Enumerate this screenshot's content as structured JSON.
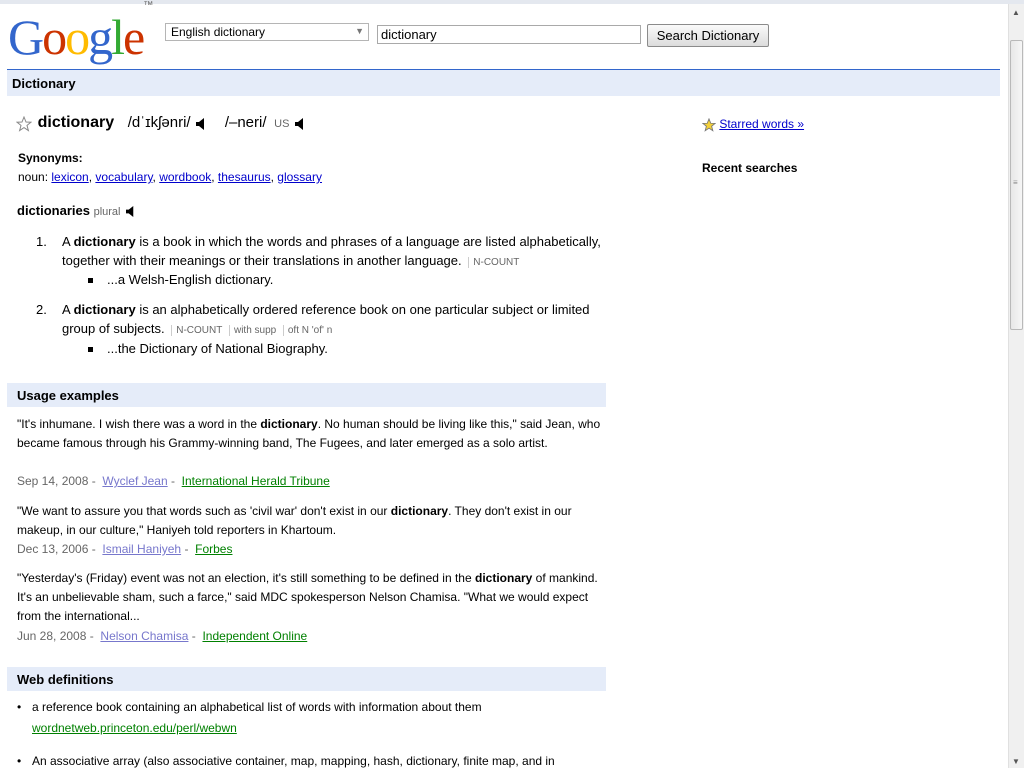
{
  "logo": {
    "letters": [
      "G",
      "o",
      "o",
      "g",
      "l",
      "e"
    ],
    "colors": [
      "#3366cc",
      "#cc3300",
      "#ffbb00",
      "#3366cc",
      "#33aa33",
      "#cc3300"
    ],
    "tm": "™"
  },
  "header": {
    "language": "English dictionary",
    "query": "dictionary",
    "search_button": "Search Dictionary"
  },
  "section_bar": "Dictionary",
  "entry": {
    "word": "dictionary",
    "ipa_uk": "/dˈɪkʃənri/",
    "ipa_us": "/–neri/",
    "us_label": "US",
    "synonyms_heading": "Synonyms:",
    "synonyms_pos": "noun:",
    "synonyms": [
      "lexicon",
      "vocabulary",
      "wordbook",
      "thesaurus",
      "glossary"
    ],
    "plural_word": "dictionaries",
    "plural_label": "plural",
    "senses": [
      {
        "num": "1.",
        "pre": "A ",
        "bold": "dictionary",
        "post": " is a book in which the words and phrases of a language are listed alphabetically, together with their meanings or their translations in another language.",
        "tags": [
          "N-COUNT"
        ],
        "example": "...a Welsh-English dictionary."
      },
      {
        "num": "2.",
        "pre": "A ",
        "bold": "dictionary",
        "post": " is an alphabetically ordered reference book on one particular subject or limited group of subjects.",
        "tags": [
          "N-COUNT",
          "with supp",
          "oft N 'of' n"
        ],
        "example": "...the Dictionary of National Biography."
      }
    ]
  },
  "usage": {
    "heading": "Usage examples",
    "items": [
      {
        "pre": "\"It's inhumane. I wish there was a word in the ",
        "bold": "dictionary",
        "post": ". No human should be living like this,\" said Jean, who became famous through his Grammy-winning band, The Fugees, and later emerged as a solo artist.",
        "date": "Sep 14, 2008 -",
        "author": "Wyclef Jean",
        "sep": "-",
        "source": "International Herald Tribune"
      },
      {
        "pre": "\"We want to assure you that words such as 'civil war' don't exist in our ",
        "bold": "dictionary",
        "post": ". They don't exist in our makeup, in our culture,\" Haniyeh told reporters in Khartoum.",
        "date": "Dec 13, 2006 -",
        "author": "Ismail Haniyeh",
        "sep": "-",
        "source": "Forbes"
      },
      {
        "pre": "\"Yesterday's (Friday) event was not an election, it's still something to be defined in the ",
        "bold": "dictionary",
        "post": " of mankind. It's an unbelievable sham, such a farce,\" said MDC spokesperson Nelson Chamisa. \"What we would expect from the international...",
        "date": "Jun 28, 2008 -",
        "author": "Nelson Chamisa",
        "sep": "-",
        "source": "Independent Online"
      }
    ]
  },
  "web_definitions": {
    "heading": "Web definitions",
    "items": [
      {
        "text": "a reference book containing an alphabetical list of words with information about them",
        "url": "wordnetweb.princeton.edu/perl/webwn"
      },
      {
        "text": "An associative array (also associative container, map, mapping, hash, dictionary, finite map, and in",
        "url": ""
      }
    ]
  },
  "sidebar": {
    "starred_label": "Starred words »",
    "recent_heading": "Recent searches"
  }
}
